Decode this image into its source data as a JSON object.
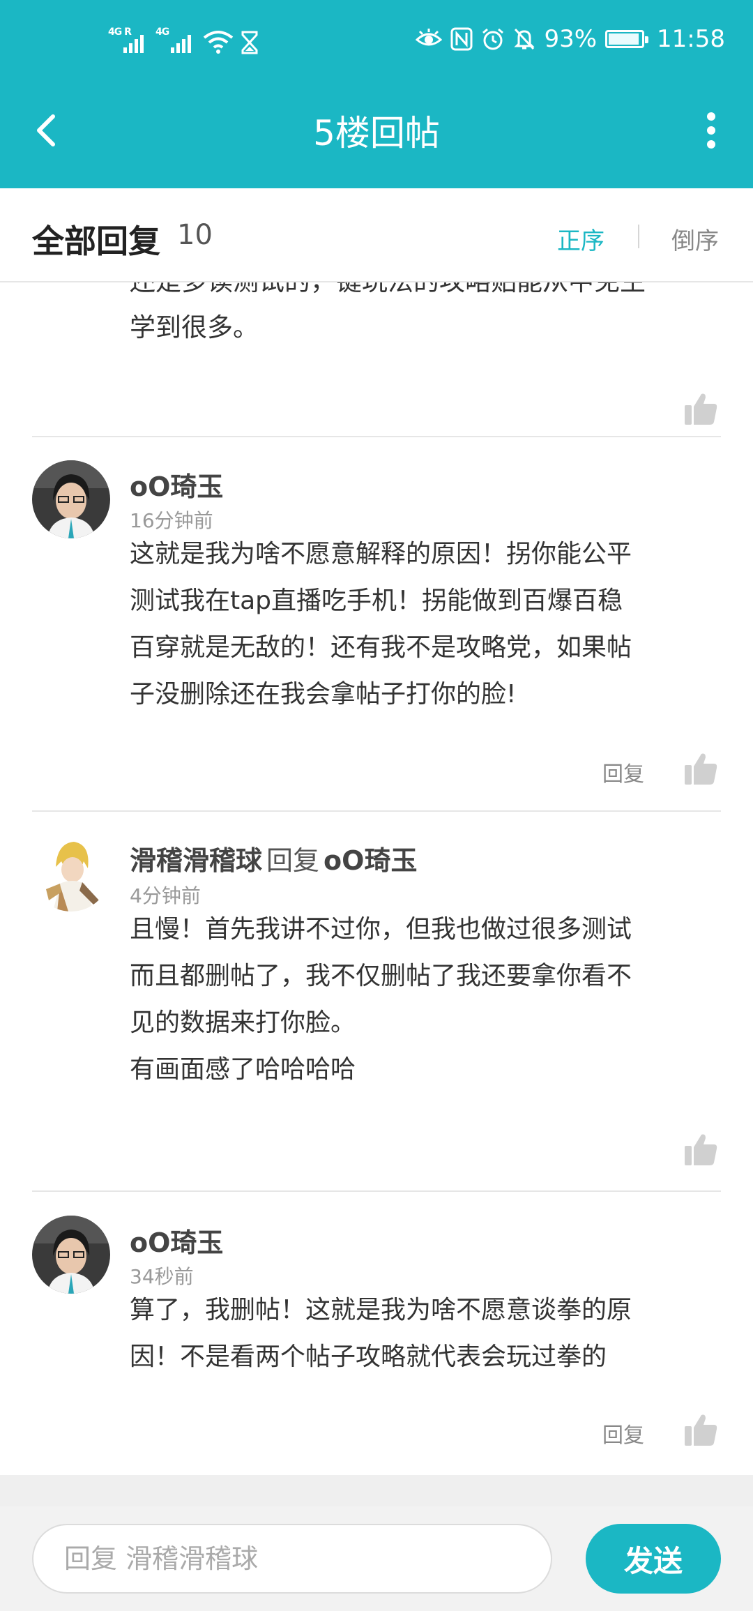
{
  "status_bar": {
    "signal_1_label": "4G R",
    "signal_2_label": "4G",
    "battery_percent": "93%",
    "time": "11:58"
  },
  "nav": {
    "title": "5楼回帖"
  },
  "reply_header": {
    "title": "全部回复",
    "count": "10",
    "sort_asc": "正序",
    "sort_desc": "倒序"
  },
  "partial_comment": {
    "line_top": "还是多读测试的，键玩法的攻略贴能从中免生",
    "line_bottom": "学到很多。"
  },
  "comments": [
    {
      "author": "oO琦玉",
      "time": "16分钟前",
      "lines": [
        "这就是我为啥不愿意解释的原因！拐你能公平",
        "测试我在tap直播吃手机！拐能做到百爆百稳",
        "百穿就是无敌的！还有我不是攻略党，如果帖",
        "子没删除还在我会拿帖子打你的脸!"
      ],
      "reply_label": "回复"
    },
    {
      "author": "滑稽滑稽球",
      "reply_word": "回复",
      "reply_to": "oO琦玉",
      "time": "4分钟前",
      "lines": [
        "且慢！首先我讲不过你，但我也做过很多测试",
        "而且都删帖了，我不仅删帖了我还要拿你看不",
        "见的数据来打你脸。",
        "有画面感了哈哈哈哈"
      ]
    },
    {
      "author": "oO琦玉",
      "time": "34秒前",
      "lines": [
        "算了，我删帖！这就是我为啥不愿意谈拳的原",
        "因！不是看两个帖子攻略就代表会玩过拳的"
      ],
      "reply_label": "回复"
    }
  ],
  "input_bar": {
    "placeholder": "回复 滑稽滑稽球",
    "send_label": "发送"
  },
  "colors": {
    "accent": "#1bb7c4",
    "text_primary": "#333333",
    "text_muted": "#999999"
  },
  "icons": [
    "back-arrow-icon",
    "more-vertical-icon",
    "signal-icon",
    "wifi-icon",
    "hourglass-icon",
    "eye-icon",
    "nfc-icon",
    "alarm-icon",
    "bell-off-icon",
    "battery-icon",
    "thumbs-up-icon"
  ]
}
